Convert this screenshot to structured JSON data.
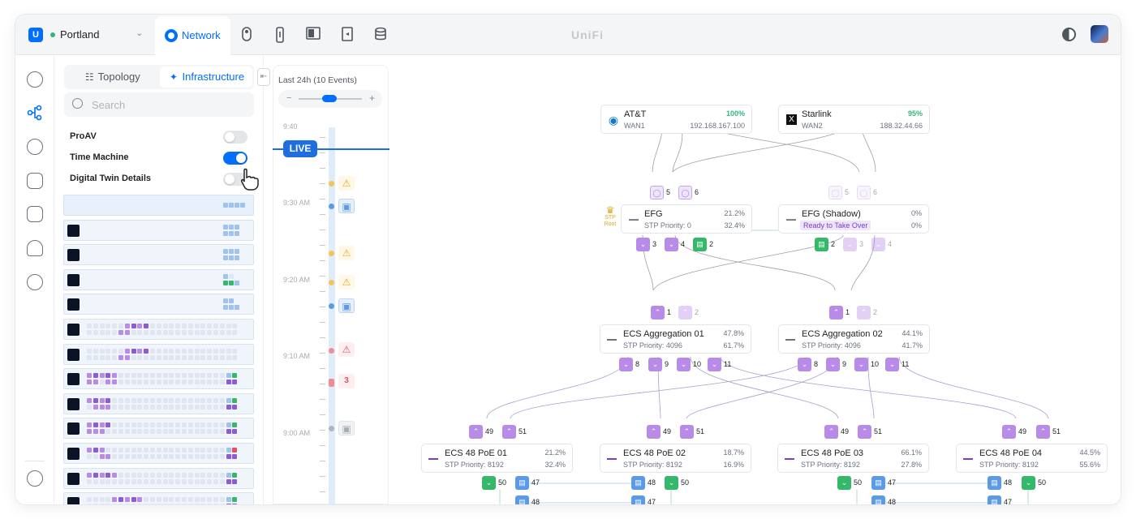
{
  "header": {
    "site": "Portland",
    "app_tab": "Network",
    "brand": "UniFi",
    "logo_letter": "U"
  },
  "panel": {
    "tabs": [
      {
        "label": "Topology",
        "icon": "topology-icon"
      },
      {
        "label": "Infrastructure",
        "icon": "infrastructure-icon"
      }
    ],
    "search_placeholder": "Search",
    "toggles": [
      {
        "label": "ProAV",
        "on": false
      },
      {
        "label": "Time Machine",
        "on": true
      },
      {
        "label": "Digital Twin Details",
        "on": false
      }
    ]
  },
  "timeline": {
    "header": "Last 24h (10 Events)",
    "live": "LIVE",
    "times": [
      "9:40",
      "9:30 AM",
      "9:20 AM",
      "9:10 AM",
      "9:00 AM"
    ],
    "count_badge": "3"
  },
  "topology": {
    "wan": [
      {
        "name": "AT&T",
        "label": "WAN1",
        "pct": "100%",
        "ip": "192.168.167.100",
        "icon": "att-logo-icon"
      },
      {
        "name": "Starlink",
        "label": "WAN2",
        "pct": "95%",
        "ip": "188.32.44.66",
        "icon": "starlink-logo-icon"
      }
    ],
    "gateways": [
      {
        "name": "EFG",
        "sub": "STP Priority: 0",
        "v1": "21.2%",
        "v2": "32.4%",
        "root": "STP Root"
      },
      {
        "name": "EFG (Shadow)",
        "sub": "Ready to Take Over",
        "v1": "0%",
        "v2": "0%"
      }
    ],
    "aggregation": [
      {
        "name": "ECS Aggregation 01",
        "sub": "STP Priority: 4096",
        "v1": "47.8%",
        "v2": "61.7%"
      },
      {
        "name": "ECS Aggregation 02",
        "sub": "STP Priority: 4096",
        "v1": "44.1%",
        "v2": "41.7%"
      }
    ],
    "access": [
      {
        "name": "ECS 48 PoE 01",
        "sub": "STP Priority: 8192",
        "v1": "21.2%",
        "v2": "32.4%"
      },
      {
        "name": "ECS 48 PoE 02",
        "sub": "STP Priority: 8192",
        "v1": "18.7%",
        "v2": "16.9%"
      },
      {
        "name": "ECS 48 PoE 03",
        "sub": "STP Priority: 8192",
        "v1": "66.1%",
        "v2": "27.8%"
      },
      {
        "name": "ECS 48 PoE 04",
        "sub": "STP Priority: 8192",
        "v1": "44.5%",
        "v2": "55.6%"
      }
    ],
    "port_labels": {
      "wan_a": [
        "5",
        "6"
      ],
      "wan_b": [
        "5",
        "6"
      ],
      "gw_a": [
        "3",
        "4",
        "2"
      ],
      "gw_b": [
        "2",
        "3",
        "4"
      ],
      "agg_up": [
        "1",
        "2"
      ],
      "agg_down": [
        "8",
        "9",
        "10",
        "11"
      ],
      "acc_up": [
        "49",
        "51"
      ],
      "acc1_down": [
        "50",
        "47",
        "48"
      ],
      "acc2_down": [
        "48",
        "50",
        "47"
      ],
      "acc3_down": [
        "50",
        "47",
        "48"
      ],
      "acc4_down": [
        "48",
        "50",
        "47"
      ]
    }
  },
  "colors": {
    "accent": "#006fff",
    "uplink": "#b98be8",
    "downlink_green": "#35b86a",
    "lag_blue": "#5a9ae6"
  }
}
